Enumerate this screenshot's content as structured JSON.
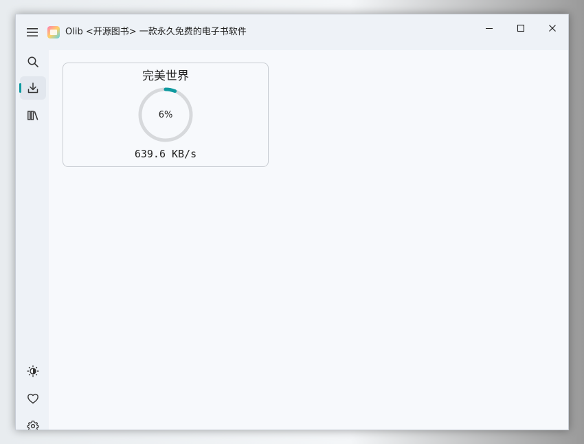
{
  "window": {
    "title": "Olib <开源图书> 一款永久免费的电子书软件",
    "controls": {
      "minimize_icon": "minimize-icon",
      "maximize_icon": "maximize-icon",
      "close_icon": "close-icon"
    }
  },
  "sidebar": {
    "top_items": [
      {
        "id": "search",
        "icon": "search-icon",
        "active": false
      },
      {
        "id": "download",
        "icon": "download-icon",
        "active": true
      },
      {
        "id": "library",
        "icon": "library-icon",
        "active": false
      }
    ],
    "bottom_items": [
      {
        "id": "theme",
        "icon": "brightness-icon"
      },
      {
        "id": "favorites",
        "icon": "heart-icon"
      },
      {
        "id": "settings",
        "icon": "gear-icon"
      }
    ]
  },
  "downloads": [
    {
      "title": "完美世界",
      "progress_percent": 6,
      "progress_label": "6%",
      "speed": "639.6 KB/s"
    }
  ],
  "colors": {
    "accent": "#0f9aa0",
    "ring_track": "#d7d9dc",
    "background": "#f7f9fc",
    "sidebar": "#eef2f7"
  }
}
